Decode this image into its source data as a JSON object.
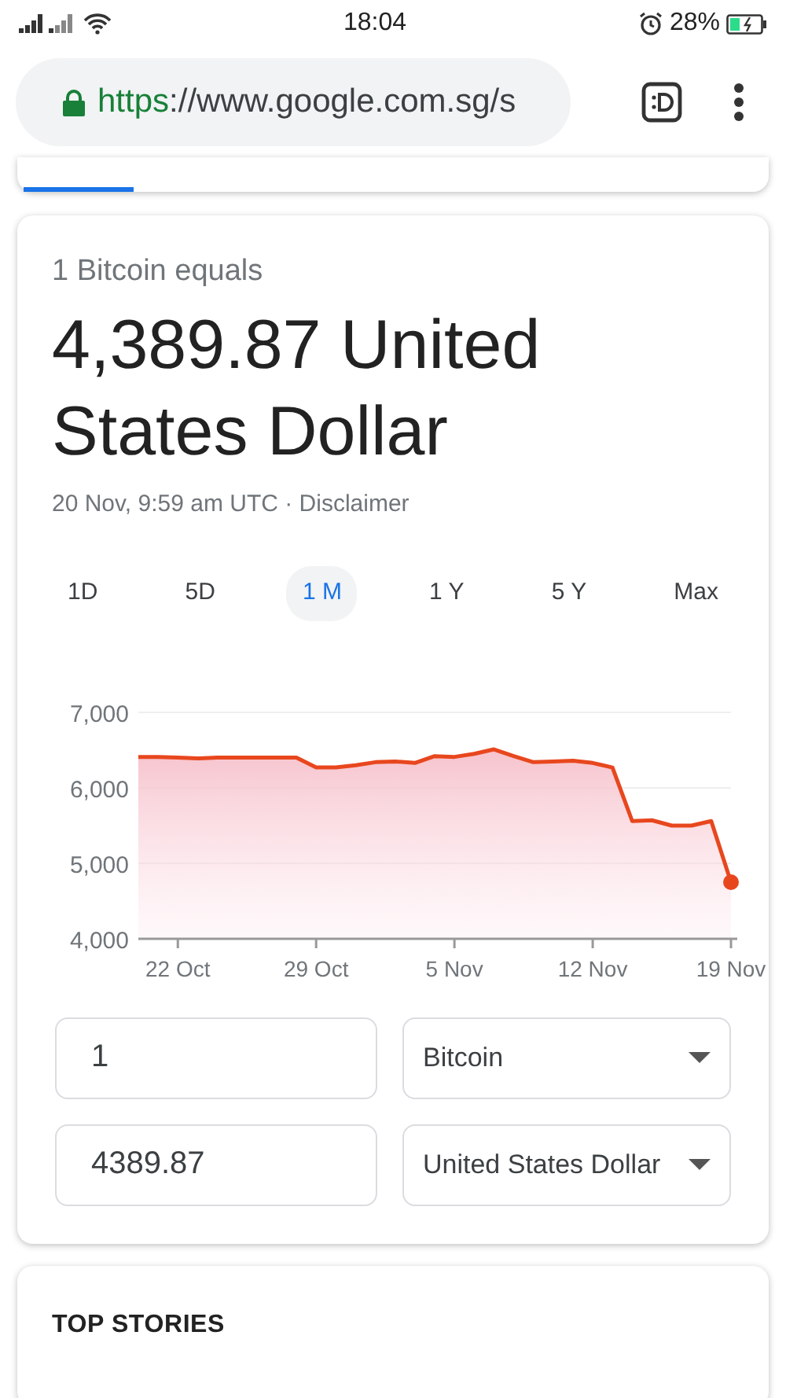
{
  "status_bar": {
    "time": "18:04",
    "battery": "28%"
  },
  "browser": {
    "url_scheme": "https",
    "url_host": "://www.google.com.sg/s"
  },
  "converter": {
    "subtitle": "1 Bitcoin equals",
    "value": "4,389.87 United States Dollar",
    "timestamp": "20 Nov, 9:59 am UTC · ",
    "disclaimer": "Disclaimer",
    "ranges": [
      {
        "label": "1D",
        "selected": false
      },
      {
        "label": "5D",
        "selected": false
      },
      {
        "label": "1 M",
        "selected": true
      },
      {
        "label": "1 Y",
        "selected": false
      },
      {
        "label": "5 Y",
        "selected": false
      },
      {
        "label": "Max",
        "selected": false
      }
    ],
    "chart_data": {
      "type": "area",
      "categories": [
        null,
        null,
        "22 Oct",
        null,
        null,
        null,
        null,
        null,
        null,
        "29 Oct",
        null,
        null,
        null,
        null,
        null,
        null,
        "5 Nov",
        null,
        null,
        null,
        null,
        null,
        null,
        "12 Nov",
        null,
        null,
        null,
        null,
        null,
        null,
        "19 Nov"
      ],
      "series": [
        {
          "color": "#e8471e",
          "values": [
            6410,
            6410,
            6400,
            6390,
            6400,
            6400,
            6400,
            6400,
            6400,
            6270,
            6270,
            6300,
            6340,
            6350,
            6330,
            6420,
            6410,
            6450,
            6510,
            6420,
            6340,
            6350,
            6360,
            6330,
            6270,
            5560,
            5570,
            5500,
            5500,
            5560,
            4750
          ]
        }
      ],
      "ylim": [
        4000,
        7000
      ],
      "yticks": [
        {
          "value": 4000,
          "label": "4,000"
        },
        {
          "value": 5000,
          "label": "5,000"
        },
        {
          "value": 6000,
          "label": "6,000"
        },
        {
          "value": 7000,
          "label": "7,000"
        }
      ]
    },
    "fields": [
      {
        "amount": "1",
        "currency": "Bitcoin"
      },
      {
        "amount": "4389.87",
        "currency": "United States Dollar"
      }
    ]
  },
  "top_stories": {
    "title": "TOP STORIES"
  }
}
